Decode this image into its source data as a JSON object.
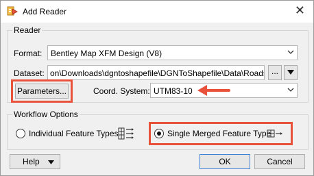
{
  "window": {
    "title": "Add Reader",
    "close_glyph": "✕"
  },
  "reader": {
    "group_label": "Reader",
    "format_label": "Format:",
    "format_value": "Bentley Map XFM Design (V8)",
    "dataset_label": "Dataset:",
    "dataset_value": "on\\Downloads\\dgntoshapefile\\DGNToShapefile\\Data\\Roads.dgn",
    "browse_label": "...",
    "parameters_label": "Parameters...",
    "coord_label": "Coord. System:",
    "coord_value": "UTM83-10"
  },
  "workflow": {
    "group_label": "Workflow Options",
    "option_individual": "Individual Feature Types",
    "option_merged": "Single Merged Feature Type",
    "selected": "merged"
  },
  "footer": {
    "help_label": "Help",
    "ok_label": "OK",
    "cancel_label": "Cancel"
  },
  "colors": {
    "highlight": "#e8513a",
    "accent": "#3c7fd8"
  }
}
